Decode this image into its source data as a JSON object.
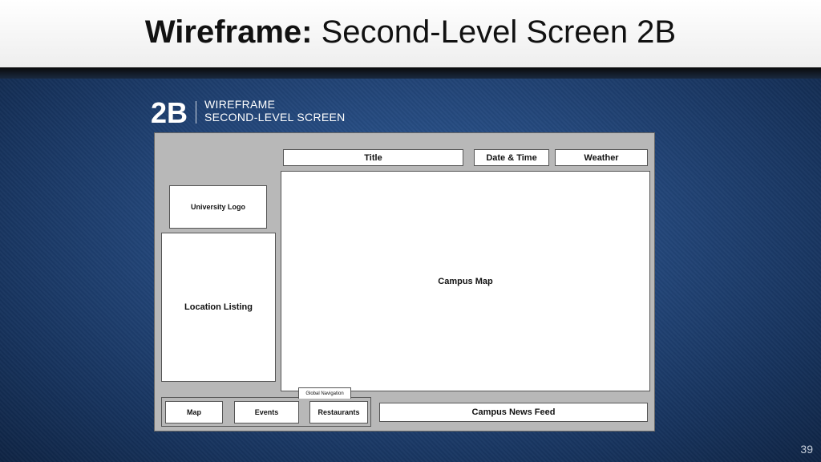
{
  "slide": {
    "title_bold": "Wireframe:",
    "title_rest": " Second-Level Screen 2B",
    "page_number": "39"
  },
  "brand": {
    "code": "2B",
    "line1": "WIREFRAME",
    "line2": "SECOND-LEVEL SCREEN"
  },
  "wireframe": {
    "title": "Title",
    "date_time": "Date & Time",
    "weather": "Weather",
    "university_logo": "University Logo",
    "location_listing": "Location Listing",
    "campus_map": "Campus Map",
    "global_navigation": "Global Navigation",
    "nav_items": [
      "Map",
      "Events",
      "Restaurants"
    ],
    "news_feed": "Campus News Feed"
  },
  "colors": {
    "background": "#24487c",
    "frame": "#b8b8b8",
    "box": "#ffffff"
  }
}
